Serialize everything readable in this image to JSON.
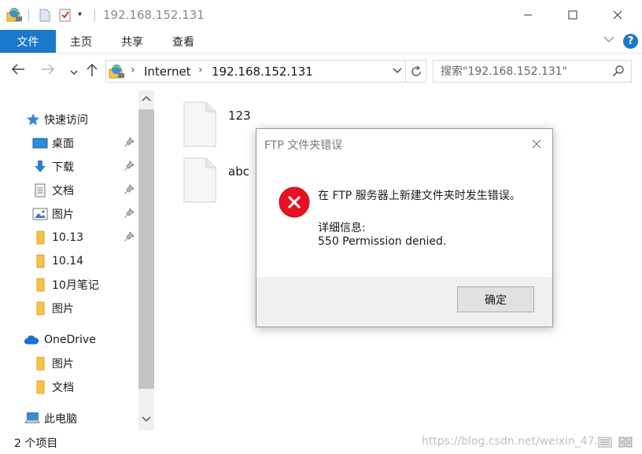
{
  "window": {
    "title": "192.168.152.131",
    "controls": {
      "minimize_icon": "minimize-icon",
      "maximize_icon": "maximize-icon",
      "close_icon": "close-icon"
    }
  },
  "ribbon": {
    "tabs": [
      {
        "label": "文件",
        "active": true
      },
      {
        "label": "主页",
        "active": false
      },
      {
        "label": "共享",
        "active": false
      },
      {
        "label": "查看",
        "active": false
      }
    ]
  },
  "navigation": {
    "breadcrumb": [
      "Internet",
      "192.168.152.131"
    ],
    "search_placeholder": "搜索\"192.168.152.131\""
  },
  "sidebar": {
    "items": [
      {
        "label": "快速访问",
        "icon": "star-icon",
        "pinned": false
      },
      {
        "label": "桌面",
        "icon": "desktop-icon",
        "pinned": true
      },
      {
        "label": "下载",
        "icon": "download-icon",
        "pinned": true
      },
      {
        "label": "文档",
        "icon": "documents-icon",
        "pinned": true
      },
      {
        "label": "图片",
        "icon": "pictures-icon",
        "pinned": true
      },
      {
        "label": "10.13",
        "icon": "folder-icon",
        "pinned": true
      },
      {
        "label": "10.14",
        "icon": "folder-icon",
        "pinned": false
      },
      {
        "label": "10月笔记",
        "icon": "folder-icon",
        "pinned": false
      },
      {
        "label": "图片",
        "icon": "folder-icon",
        "pinned": false
      },
      {
        "label": "OneDrive",
        "icon": "cloud-icon",
        "pinned": false
      },
      {
        "label": "图片",
        "icon": "folder-icon",
        "pinned": false
      },
      {
        "label": "文档",
        "icon": "folder-icon",
        "pinned": false
      },
      {
        "label": "此电脑",
        "icon": "computer-icon",
        "pinned": false
      }
    ]
  },
  "content": {
    "files": [
      {
        "name": "123",
        "icon": "file-icon"
      },
      {
        "name": "abc",
        "icon": "file-icon"
      }
    ]
  },
  "status": {
    "item_count": "2 个项目",
    "watermark": "https://blog.csdn.net/weixin_47..."
  },
  "dialog": {
    "title": "FTP 文件夹错误",
    "message": "在 FTP 服务器上新建文件夹时发生错误。",
    "detail_label": "详细信息:",
    "detail": "550 Permission denied.",
    "ok_label": "确定",
    "colors": {
      "error_red": "#e81123"
    }
  },
  "colors": {
    "accent": "#1979ca",
    "folder_yellow": "#f4c247"
  }
}
